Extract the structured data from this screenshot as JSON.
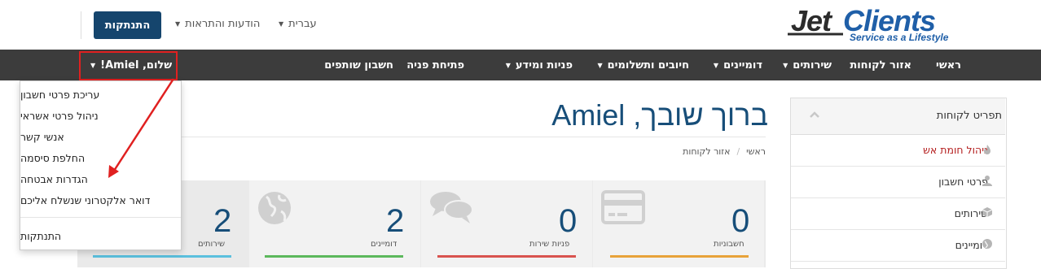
{
  "header": {
    "logo_main": "JetClients",
    "logo_tagline": "Service as a Lifestyle",
    "logout_button": "התנתקות",
    "notifications_label": "הודעות והתראות",
    "language_label": "עברית"
  },
  "nav": {
    "items": [
      "ראשי",
      "אזור לקוחות",
      "שירותים",
      "דומיינים",
      "חיובים ותשלומים",
      "פניות ומידע",
      "פתיחת פניה",
      "חשבון שותפים"
    ],
    "greeting": "שלום, Amiel!"
  },
  "account_menu": {
    "items": [
      "עריכת פרטי חשבון",
      "ניהול פרטי אשראי",
      "אנשי קשר",
      "החלפת סיסמה",
      "הגדרות אבטחה",
      "דואר אלקטרוני שנשלח אליכם"
    ],
    "logout": "התנתקות"
  },
  "page": {
    "title": "ברוך שובך, Amiel",
    "breadcrumb": [
      "ראשי",
      "אזור לקוחות"
    ]
  },
  "stats": [
    {
      "label": "חשבוניות",
      "value": "0",
      "color": "#e8a33a"
    },
    {
      "label": "פניות שירות",
      "value": "0",
      "color": "#d9534f"
    },
    {
      "label": "דומיינים",
      "value": "2",
      "color": "#5cb85c"
    },
    {
      "label": "שירותים",
      "value": "2",
      "color": "#5bc0de"
    }
  ],
  "sidebar": {
    "title": "תפריט לקוחות",
    "items": [
      {
        "label": "ניהול חומת אש",
        "icon": "fire-icon"
      },
      {
        "label": "פרטי חשבון",
        "icon": "user-icon"
      },
      {
        "label": "שירותים",
        "icon": "cube-icon"
      },
      {
        "label": "דומיינים",
        "icon": "globe-icon"
      }
    ]
  },
  "colors": {
    "brand": "#15456d",
    "nav_bg": "#3c3c3c",
    "highlight": "#e02020",
    "firewall_text": "#b52020"
  }
}
